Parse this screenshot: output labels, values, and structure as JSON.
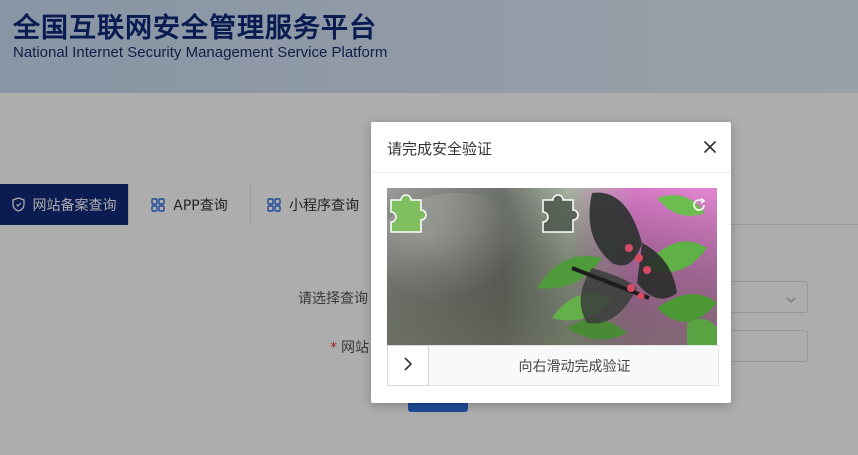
{
  "header": {
    "title": "全国互联网安全管理服务平台",
    "subtitle": "National Internet Security Management Service Platform"
  },
  "tabs": [
    {
      "label": "网站备案查询",
      "icon": "shield-icon",
      "active": true
    },
    {
      "label": "APP查询",
      "icon": "grid-icon",
      "active": false
    },
    {
      "label": "小程序查询",
      "icon": "grid-icon",
      "active": false
    }
  ],
  "form": {
    "type_label": "请选择查询",
    "site_label": "网站",
    "required_mark": "*"
  },
  "dialog": {
    "title": "请完成安全验证",
    "slider_hint": "向右滑动完成验证"
  },
  "colors": {
    "brand_navy": "#0f2a7a",
    "title_navy": "#0e2a78",
    "button_blue": "#2f6fe0",
    "required_red": "#e03c3c"
  }
}
